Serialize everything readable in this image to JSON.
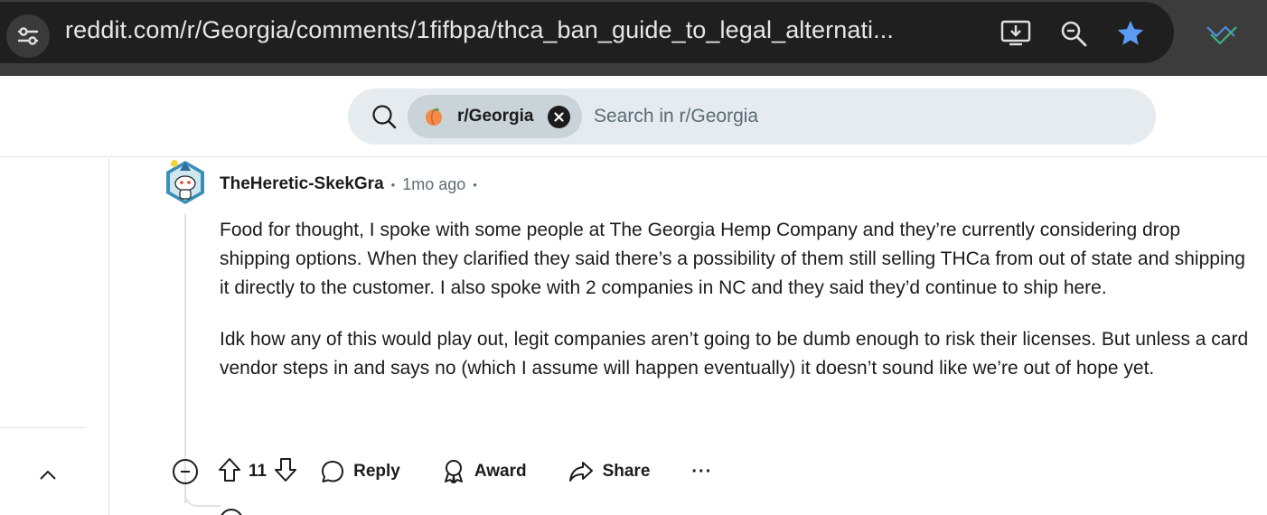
{
  "browser": {
    "url": "reddit.com/r/Georgia/comments/1fifbpa/thca_ban_guide_to_legal_alternati...",
    "icons": [
      "site-info-icon",
      "install-app-icon",
      "zoom-icon",
      "bookmark-star-icon",
      "extension-icon"
    ],
    "star_color": "#5b9bf6"
  },
  "search": {
    "chip_label": "r/Georgia",
    "placeholder": "Search in r/Georgia"
  },
  "comment": {
    "author": "TheHeretic-SkekGra",
    "sep": "•",
    "time": "1mo ago",
    "paragraphs": [
      "Food for thought, I spoke with some people at The Georgia Hemp Company and they’re currently considering drop shipping options. When they clarified they said there’s a possibility of them still selling THCa from out of state and shipping it directly to the customer. I also spoke with 2 companies in NC and they said they’d continue to ship here.",
      "Idk how any of this would play out, legit companies aren’t going to be dumb enough to risk their licenses. But unless a card vendor steps in and says no (which I assume will happen eventually) it doesn’t sound like we’re out of hope yet."
    ],
    "score": "11",
    "actions": {
      "reply": "Reply",
      "award": "Award",
      "share": "Share",
      "more": "···"
    }
  }
}
